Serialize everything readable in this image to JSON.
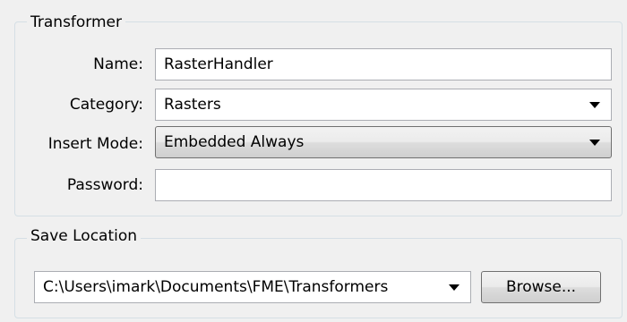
{
  "transformer_group": {
    "title": "Transformer",
    "name_label": "Name:",
    "name_value": "RasterHandler",
    "category_label": "Category:",
    "category_value": "Rasters",
    "insert_mode_label": "Insert Mode:",
    "insert_mode_value": "Embedded Always",
    "password_label": "Password:",
    "password_value": ""
  },
  "save_location_group": {
    "title": "Save Location",
    "path_value": "C:\\Users\\imark\\Documents\\FME\\Transformers",
    "browse_label": "Browse..."
  },
  "icons": {
    "dropdown": "chevron-down-icon"
  }
}
